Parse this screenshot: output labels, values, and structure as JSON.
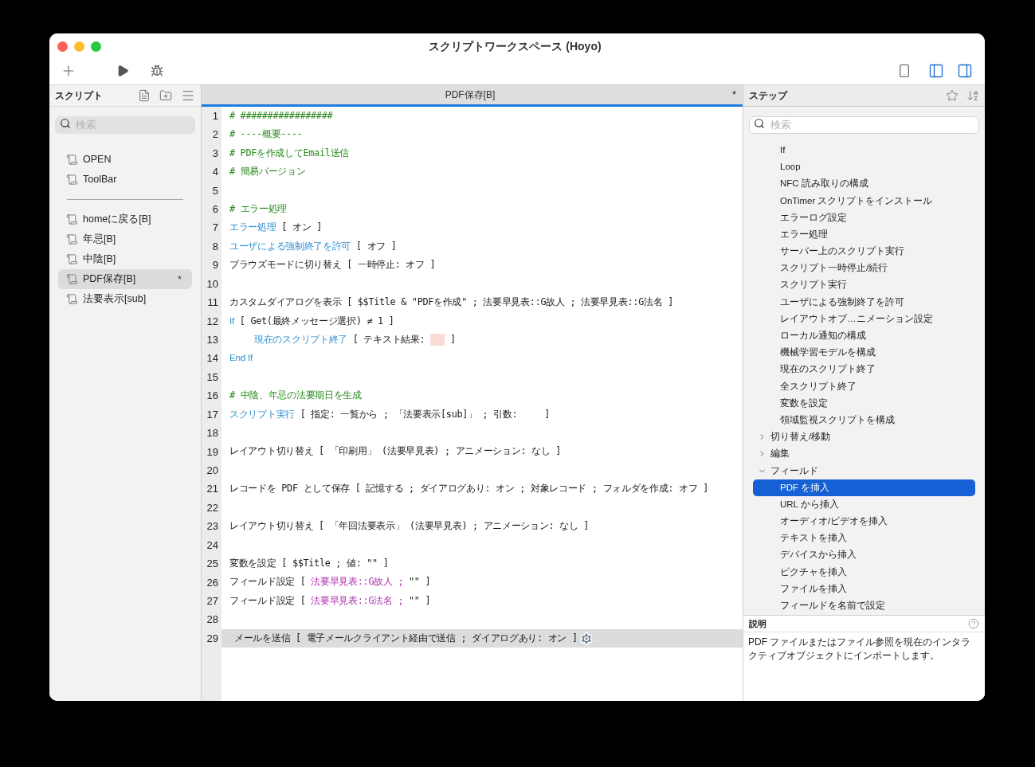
{
  "window": {
    "title": "スクリプトワークスペース (Hoyo)"
  },
  "scripts_panel": {
    "title": "スクリプト",
    "search": {
      "placeholder": "検索"
    },
    "groups": [
      [
        {
          "label": "OPEN",
          "selected": false
        },
        {
          "label": "ToolBar",
          "selected": false
        }
      ],
      [
        {
          "label": "homeに戻る[B]",
          "selected": false
        },
        {
          "label": "年忌[B]",
          "selected": false
        },
        {
          "label": "中陰[B]",
          "selected": false
        },
        {
          "label": "PDF保存[B]",
          "selected": true,
          "marker": "*"
        },
        {
          "label": "法要表示[sub]",
          "selected": false
        }
      ]
    ]
  },
  "editor": {
    "tab": {
      "title": "PDF保存[B]",
      "marker": "*"
    },
    "lines": [
      {
        "number": "1",
        "selected": false,
        "segments": [
          {
            "kind": "comment",
            "text": "# #################"
          }
        ]
      },
      {
        "number": "2",
        "selected": false,
        "segments": [
          {
            "kind": "comment",
            "text": "# ----概要----"
          }
        ]
      },
      {
        "number": "3",
        "selected": false,
        "segments": [
          {
            "kind": "comment",
            "text": "# PDFを作成してEmail送信"
          }
        ]
      },
      {
        "number": "4",
        "selected": false,
        "segments": [
          {
            "kind": "comment",
            "text": "# 簡易バージョン"
          }
        ]
      },
      {
        "number": "5",
        "selected": false
      },
      {
        "number": "6",
        "selected": false,
        "segments": [
          {
            "kind": "comment",
            "text": "# エラー処理"
          }
        ]
      },
      {
        "number": "7",
        "selected": false,
        "segments": [
          {
            "kind": "step",
            "text": "エラー処理"
          },
          {
            "kind": "text",
            "text": " [ オン ]"
          }
        ]
      },
      {
        "number": "8",
        "selected": false,
        "segments": [
          {
            "kind": "step",
            "text": "ユーザによる強制終了を許可"
          },
          {
            "kind": "text",
            "text": " [ オフ ]"
          }
        ]
      },
      {
        "number": "9",
        "selected": false,
        "segments": [
          {
            "kind": "text",
            "text": "ブラウズモードに切り替え [ 一時停止: オフ ]"
          }
        ]
      },
      {
        "number": "10",
        "selected": false
      },
      {
        "number": "11",
        "selected": false,
        "segments": [
          {
            "kind": "text",
            "text": "カスタムダイアログを表示 [ $$Title & \"PDFを作成\" ; 法要早見表::G故人 ; 法要早見表::G法名 ]"
          }
        ]
      },
      {
        "number": "12",
        "selected": false,
        "segments": [
          {
            "kind": "step",
            "text": "If"
          },
          {
            "kind": "text",
            "text": " [ Get(最終メッセージ選択) ≠ 1 ]"
          }
        ],
        "children": [
          {
            "number": "13",
            "selected": false,
            "segments": [
              {
                "kind": "step",
                "text": "現在のスクリプト終了"
              },
              {
                "kind": "text",
                "text": " [ テキスト結果: "
              },
              {
                "kind": "empty"
              },
              {
                "kind": "text",
                "text": " ]"
              }
            ]
          }
        ]
      },
      {
        "number": "14",
        "selected": false,
        "segments": [
          {
            "kind": "step",
            "text": "End If"
          }
        ]
      },
      {
        "number": "15",
        "selected": false
      },
      {
        "number": "16",
        "selected": false,
        "segments": [
          {
            "kind": "comment",
            "text": "# 中陰、年忌の法要期日を生成"
          }
        ]
      },
      {
        "number": "17",
        "selected": false,
        "segments": [
          {
            "kind": "step",
            "text": "スクリプト実行"
          },
          {
            "kind": "text",
            "text": " [ 指定: 一覧から ; 「法要表示[sub]」 ; 引数:     ]"
          }
        ]
      },
      {
        "number": "18",
        "selected": false
      },
      {
        "number": "19",
        "selected": false,
        "segments": [
          {
            "kind": "text",
            "text": "レイアウト切り替え [ 「印刷用」 (法要早見表) ; アニメーション: なし ]"
          }
        ]
      },
      {
        "number": "20",
        "selected": false
      },
      {
        "number": "21",
        "selected": false,
        "segments": [
          {
            "kind": "text",
            "text": "レコードを PDF として保存 [ 記憶する ; ダイアログあり: オン ; 対象レコード ; フォルダを作成: オフ ]"
          }
        ]
      },
      {
        "number": "22",
        "selected": false
      },
      {
        "number": "23",
        "selected": false,
        "segments": [
          {
            "kind": "text",
            "text": "レイアウト切り替え [ 「年回法要表示」 (法要早見表) ; アニメーション: なし ]"
          }
        ]
      },
      {
        "number": "24",
        "selected": false
      },
      {
        "number": "25",
        "selected": false,
        "segments": [
          {
            "kind": "text",
            "text": "変数を設定 [ $$Title ; 値: \"\" ]"
          }
        ]
      },
      {
        "number": "26",
        "selected": false,
        "segments": [
          {
            "kind": "text",
            "text": "フィールド設定 [ "
          },
          {
            "kind": "field",
            "text": "法要早見表::G故人 ;"
          },
          {
            "kind": "text",
            "text": " \"\" ]"
          }
        ]
      },
      {
        "number": "27",
        "selected": false,
        "segments": [
          {
            "kind": "text",
            "text": "フィールド設定 [ "
          },
          {
            "kind": "field",
            "text": "法要早見表::G法名 ;"
          },
          {
            "kind": "text",
            "text": " \"\" ]"
          }
        ]
      },
      {
        "number": "28",
        "selected": false
      },
      {
        "number": "29",
        "selected": true,
        "segments": [
          {
            "kind": "text",
            "text": "メールを送信 [ 電子メールクライアント経由で送信 ; ダイアログあり: オン ]"
          }
        ]
      }
    ]
  },
  "steps_panel": {
    "title": "ステップ",
    "search": {
      "placeholder": "検索"
    },
    "steps_continued": [
      {
        "label": "If",
        "selected": false
      },
      {
        "label": "Loop",
        "selected": false
      },
      {
        "label": "NFC 読み取りの構成",
        "selected": false
      },
      {
        "label": "OnTimer スクリプトをインストール",
        "selected": false
      },
      {
        "label": "エラーログ設定",
        "selected": false
      },
      {
        "label": "エラー処理",
        "selected": false
      },
      {
        "label": "サーバー上のスクリプト実行",
        "selected": false
      },
      {
        "label": "スクリプト一時停止/続行",
        "selected": false
      },
      {
        "label": "スクリプト実行",
        "selected": false
      },
      {
        "label": "ユーザによる強制終了を許可",
        "selected": false
      },
      {
        "label": "レイアウトオブ…ニメーション設定",
        "selected": false
      },
      {
        "label": "ローカル通知の構成",
        "selected": false
      },
      {
        "label": "機械学習モデルを構成",
        "selected": false
      },
      {
        "label": "現在のスクリプト終了",
        "selected": false
      },
      {
        "label": "全スクリプト終了",
        "selected": false
      },
      {
        "label": "変数を設定",
        "selected": false
      },
      {
        "label": "領域監視スクリプトを構成",
        "selected": false
      }
    ],
    "groups": [
      {
        "label": "切り替え/移動",
        "expanded": false
      },
      {
        "label": "編集",
        "expanded": false
      },
      {
        "label": "フィールド",
        "expanded": true,
        "children": [
          {
            "label": "PDF を挿入",
            "selected": true
          },
          {
            "label": "URL から挿入",
            "selected": false
          },
          {
            "label": "オーディオ/ビデオを挿入",
            "selected": false
          },
          {
            "label": "テキストを挿入",
            "selected": false
          },
          {
            "label": "デバイスから挿入",
            "selected": false
          },
          {
            "label": "ピクチャを挿入",
            "selected": false
          },
          {
            "label": "ファイルを挿入",
            "selected": false
          },
          {
            "label": "フィールドを名前で設定",
            "selected": false
          }
        ]
      }
    ],
    "description": {
      "title": "説明",
      "text": "PDF ファイルまたはファイル参照を現在のインタラクティブオブジェクトにインポートします。"
    }
  }
}
